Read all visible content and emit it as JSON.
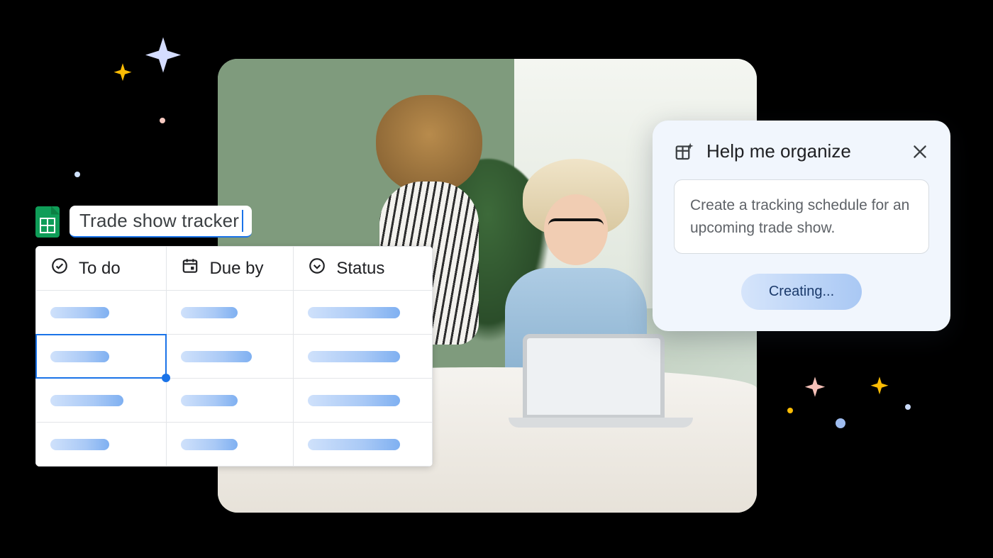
{
  "doc_title": "Trade show tracker",
  "columns": {
    "todo": "To do",
    "dueby": "Due by",
    "status": "Status"
  },
  "help": {
    "title": "Help me organize",
    "prompt": "Create a tracking schedule for an upcoming trade show.",
    "button": "Creating..."
  },
  "icons": {
    "sheets": "google-sheets-icon",
    "todo": "check-circle-icon",
    "dueby": "calendar-icon",
    "status": "chevron-circle-icon",
    "organize": "table-sparkle-icon",
    "close": "close-icon"
  }
}
